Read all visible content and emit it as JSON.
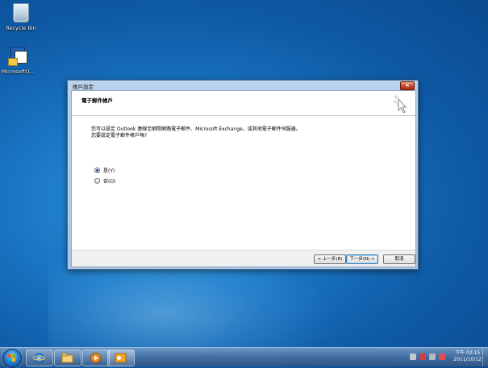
{
  "desktop": {
    "icons": [
      {
        "label": "Recycle Bin"
      },
      {
        "label": "MicrosoftO..."
      }
    ]
  },
  "dialog": {
    "title": "帳戶設定",
    "header": "電子郵件帳戶",
    "text_line1": "您可以設定 Outlook 連線至網際網路電子郵件、Microsoft Exchange，或其他電子郵件伺服器。",
    "text_line2": "您要設定電子郵件帳戶嗎?",
    "options": [
      {
        "label": "是(Y)",
        "selected": true
      },
      {
        "label": "否(O)",
        "selected": false
      }
    ],
    "buttons": {
      "back": "< 上一步(B)",
      "next": "下一步(N) >",
      "cancel": "取消"
    }
  },
  "taskbar": {
    "time": "下午 02:15",
    "date": "2011/10/12",
    "colors": {
      "accent": "#1a76c4"
    }
  }
}
